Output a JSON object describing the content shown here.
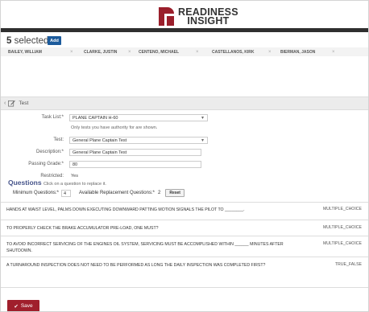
{
  "header": {
    "logo_line1": "READINESS",
    "logo_line2": "INSIGHT",
    "brand_color": "#9a1f2b"
  },
  "selection": {
    "count": "5",
    "label": "selected",
    "add_label": "Add",
    "people": [
      {
        "name": "BAILEY, WILLIAM"
      },
      {
        "name": "CLARKE, JUSTIN"
      },
      {
        "name": "CENTENO, MICHAEL"
      },
      {
        "name": "CASTELLANOS, KIRK"
      },
      {
        "name": "BIERMAN, JASON"
      }
    ],
    "remove_glyph": "×"
  },
  "test_section": {
    "title": "Test",
    "chevron": "‹",
    "edit_icon": "edit-icon"
  },
  "form": {
    "task_list_label": "Task List:*",
    "task_list_value": "PLANE CAPTAIN H-60",
    "task_list_note": "Only tests you have authority for are shown.",
    "test_label": "Test:",
    "test_value": "General Plane Captain Test",
    "description_label": "Description:*",
    "description_value": "General Plane Captain Test",
    "passing_grade_label": "Passing Grade:*",
    "passing_grade_value": "80",
    "restricted_label": "Restricted:",
    "restricted_value": "Yes"
  },
  "questions": {
    "title": "Questions",
    "hint": "Click on a question to replace it.",
    "min_label": "Minimum Questions:*",
    "min_value": "4",
    "available_label": "Available Replacement Questions:*",
    "available_value": "2",
    "reset_label": "Reset",
    "items": [
      {
        "text": "HANDS AT WAIST LEVEL, PALMS DOWN EXECUTING DOWNWARD PATTING MOTION SIGNALS THE PILOT TO ________.",
        "type": "MULTIPLE_CHOICE"
      },
      {
        "text": "TO PROPERLY CHECK THE BRAKE ACCUMULATOR PRE-LOAD, ONE MUST?",
        "type": "MULTIPLE_CHOICE"
      },
      {
        "text": "TO AVOID INCORRECT SERVICING OF THE ENGINES OIL SYSTEM, SERVICING MUST BE ACCOMPLISHED WITHIN ______ MINUTES AFTER SHUTDOWN.",
        "type": "MULTIPLE_CHOICE"
      },
      {
        "text": "A TURNAROUND INSPECTION DOES NOT NEED TO BE PERFORMED AS LONG THE DAILY INSPECTION WAS COMPLETED FIRST?",
        "type": "TRUE_FALSE"
      }
    ]
  },
  "footer": {
    "save_label": "Save",
    "save_icon": "check-icon"
  }
}
